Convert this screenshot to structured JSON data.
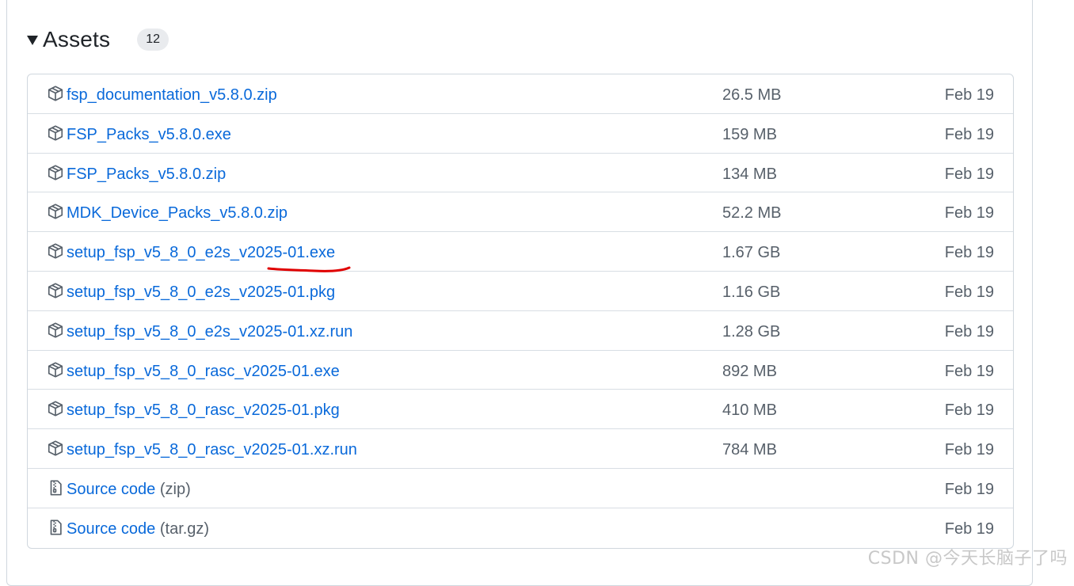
{
  "assets": {
    "title": "Assets",
    "count": "12",
    "items": [
      {
        "name": "fsp_documentation_v5.8.0.zip",
        "suffix": "",
        "size": "26.5 MB",
        "date": "Feb 19",
        "icon": "package-icon"
      },
      {
        "name": "FSP_Packs_v5.8.0.exe",
        "suffix": "",
        "size": "159 MB",
        "date": "Feb 19",
        "icon": "package-icon"
      },
      {
        "name": "FSP_Packs_v5.8.0.zip",
        "suffix": "",
        "size": "134 MB",
        "date": "Feb 19",
        "icon": "package-icon"
      },
      {
        "name": "MDK_Device_Packs_v5.8.0.zip",
        "suffix": "",
        "size": "52.2 MB",
        "date": "Feb 19",
        "icon": "package-icon"
      },
      {
        "name": "setup_fsp_v5_8_0_e2s_v2025-01.exe",
        "suffix": "",
        "size": "1.67 GB",
        "date": "Feb 19",
        "icon": "package-icon"
      },
      {
        "name": "setup_fsp_v5_8_0_e2s_v2025-01.pkg",
        "suffix": "",
        "size": "1.16 GB",
        "date": "Feb 19",
        "icon": "package-icon"
      },
      {
        "name": "setup_fsp_v5_8_0_e2s_v2025-01.xz.run",
        "suffix": "",
        "size": "1.28 GB",
        "date": "Feb 19",
        "icon": "package-icon"
      },
      {
        "name": "setup_fsp_v5_8_0_rasc_v2025-01.exe",
        "suffix": "",
        "size": "892 MB",
        "date": "Feb 19",
        "icon": "package-icon"
      },
      {
        "name": "setup_fsp_v5_8_0_rasc_v2025-01.pkg",
        "suffix": "",
        "size": "410 MB",
        "date": "Feb 19",
        "icon": "package-icon"
      },
      {
        "name": "setup_fsp_v5_8_0_rasc_v2025-01.xz.run",
        "suffix": "",
        "size": "784 MB",
        "date": "Feb 19",
        "icon": "package-icon"
      },
      {
        "name": "Source code",
        "suffix": " (zip)",
        "size": "",
        "date": "Feb 19",
        "icon": "file-zip-icon"
      },
      {
        "name": "Source code",
        "suffix": " (tar.gz)",
        "size": "",
        "date": "Feb 19",
        "icon": "file-zip-icon"
      }
    ]
  },
  "watermark": "CSDN @今天长脑子了吗",
  "colors": {
    "link": "#0969da",
    "muted": "#57606a",
    "annotation": "#e00000"
  }
}
